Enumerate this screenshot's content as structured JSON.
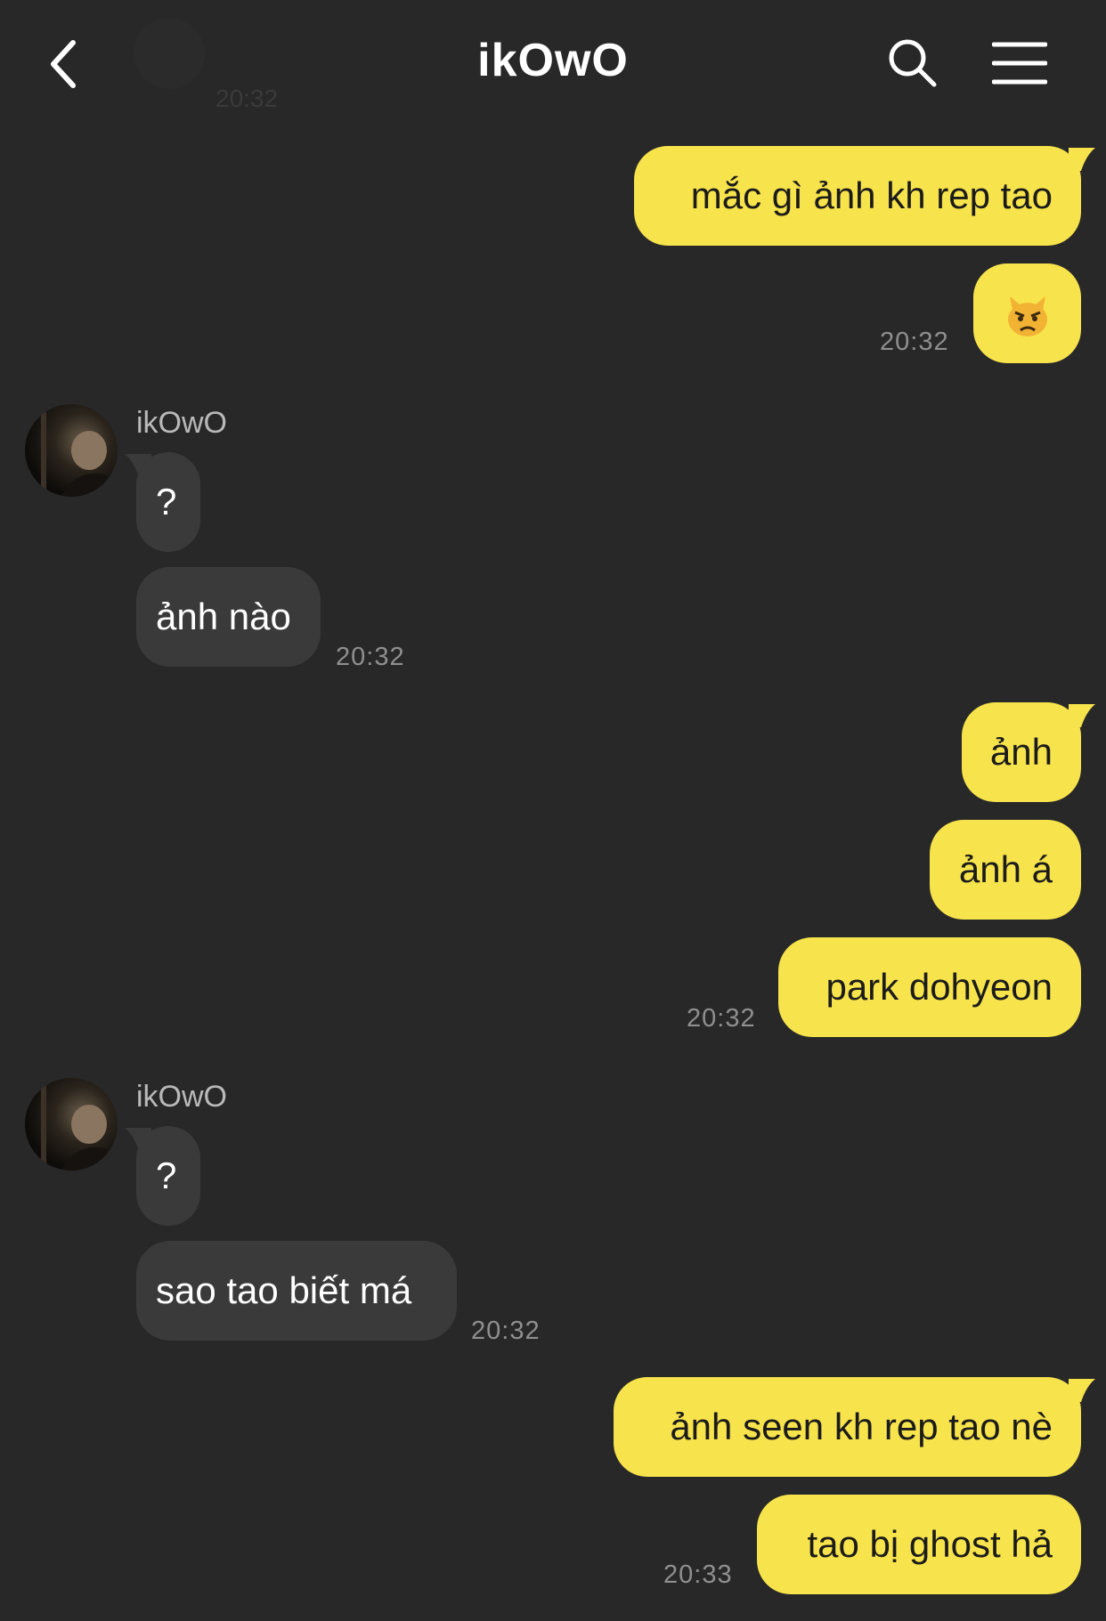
{
  "header": {
    "title": "ikOwO"
  },
  "background": {
    "ghost_time": "20:32"
  },
  "messages": {
    "m1": {
      "text": "mắc gì ảnh kh rep tao"
    },
    "m2": {
      "emoji": "pouting-cat-emoji",
      "time": "20:32"
    },
    "g1": {
      "sender": "ikOwO",
      "line1": "?",
      "line2": "ảnh nào",
      "time": "20:32"
    },
    "m3": {
      "text": "ảnh"
    },
    "m4": {
      "text": "ảnh á"
    },
    "m5": {
      "text": "park dohyeon",
      "time": "20:32"
    },
    "g2": {
      "sender": "ikOwO",
      "line1": "?",
      "line2": "sao tao biết má",
      "time": "20:32"
    },
    "m6": {
      "text": "ảnh seen kh rep tao nè"
    },
    "m7": {
      "text": "tao bị ghost hả",
      "time": "20:33"
    }
  },
  "colors": {
    "background": "#282829",
    "my_bubble": "#f7e34b",
    "their_bubble": "#3a3a3b",
    "timestamp": "#8f8f90"
  }
}
